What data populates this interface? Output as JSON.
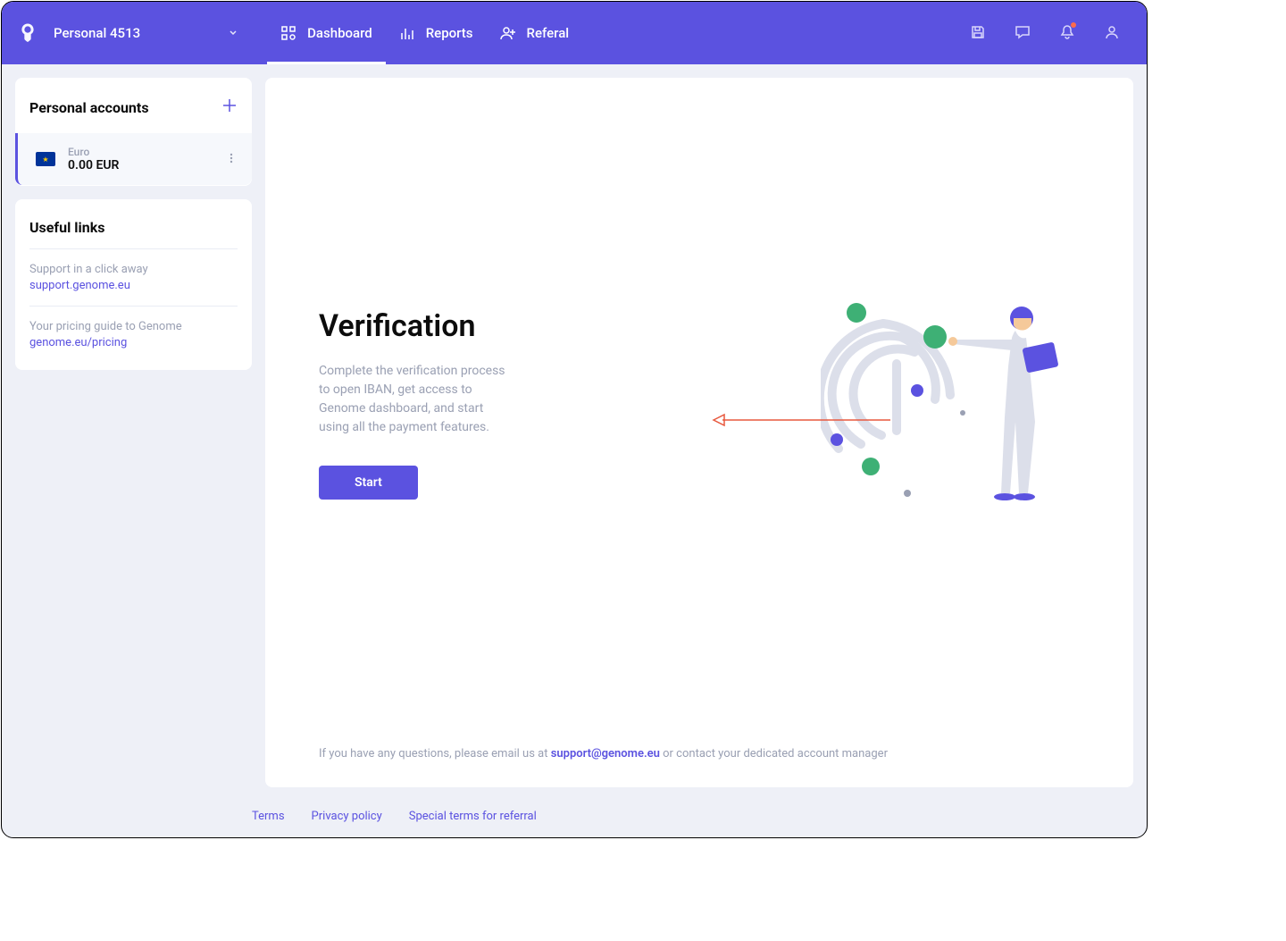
{
  "header": {
    "account_selector": "Personal  4513",
    "nav": {
      "dashboard": "Dashboard",
      "reports": "Reports",
      "referal": "Referal"
    }
  },
  "sidebar": {
    "accounts_title": "Personal accounts",
    "accounts": [
      {
        "currency": "Euro",
        "balance": "0.00 EUR"
      }
    ],
    "useful_links_title": "Useful links",
    "links": [
      {
        "desc": "Support in a click away",
        "url": "support.genome.eu"
      },
      {
        "desc": "Your pricing guide to Genome",
        "url": "genome.eu/pricing"
      }
    ]
  },
  "main": {
    "verification_title": "Verification",
    "verification_desc": "Complete the verification process to open IBAN, get access to Genome dashboard, and start using all the payment features.",
    "start_button": "Start",
    "footer_prefix": "If you have any questions, please email us at ",
    "footer_email": "support@genome.eu",
    "footer_suffix": " or contact your dedicated account manager"
  },
  "footer": {
    "terms": "Terms",
    "privacy": "Privacy policy",
    "referral": "Special terms for referral"
  },
  "colors": {
    "primary": "#5b52e0",
    "accent_green": "#3eb075",
    "accent_orange": "#ff6b4a"
  }
}
